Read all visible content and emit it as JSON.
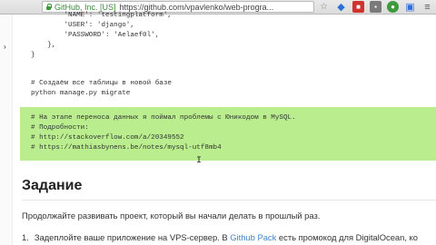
{
  "browser": {
    "cert_label": "GitHub, Inc. [US]",
    "url": "https://github.com/vpavlenko/web-progra..."
  },
  "code": {
    "lines": [
      "        'NAME': 'testingplatform',",
      "        'USER': 'django',",
      "        'PASSWORD': 'Aelaef0l',",
      "    },",
      "}",
      "",
      "# Создаём все таблицы в новой базе",
      "python manage.py migrate",
      "",
      "",
      "# На этапе переноса данных я поймал проблемы с Юникодом в MySQL.",
      "# Подробности:",
      "# http://stackoverflow.com/a/20349552",
      "# https://mathiasbynens.be/notes/mysql-utf8mb4"
    ]
  },
  "article": {
    "heading": "Задание",
    "paragraph": "Продолжайте развивать проект, который вы начали делать в прошлый раз.",
    "list_number": "1.",
    "list_text_before": "Задеплойте ваше приложение на VPS-сервер. В ",
    "list_link": "Github Pack",
    "list_text_after": " есть промокод для DigitalOcean, ко"
  }
}
